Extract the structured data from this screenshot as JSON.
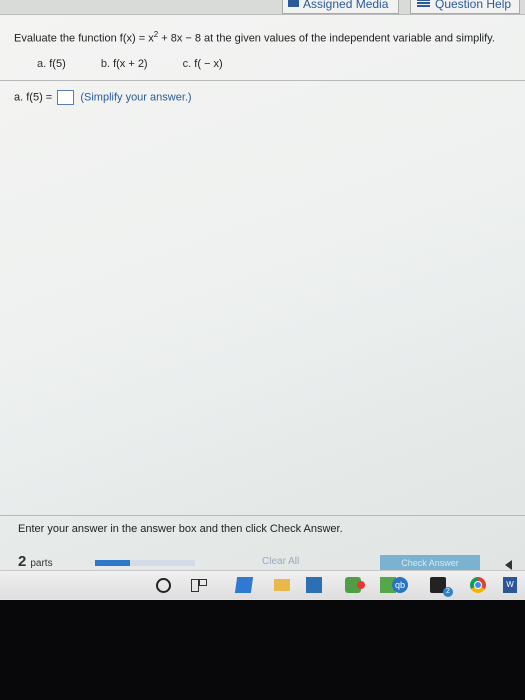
{
  "header": {
    "assigned_media": "Assigned Media",
    "question_help": "Question Help"
  },
  "question": {
    "prefix": "Evaluate the function f(x)",
    "eq": " = x",
    "exp": "2",
    "suffix": " + 8x − 8 at the given values of the independent variable and simplify.",
    "parts": [
      {
        "letter": "a.",
        "expr": "f(5)"
      },
      {
        "letter": "b.",
        "expr": "f(x + 2)"
      },
      {
        "letter": "c.",
        "expr": "f( − x)"
      }
    ]
  },
  "answer": {
    "label": "a.  f(5) =",
    "value": "",
    "hint": "(Simplify your answer.)"
  },
  "footer": {
    "instruction": "Enter your answer in the answer box and then click Check Answer.",
    "parts_count": "2",
    "parts_label": "parts",
    "progress": 0.35,
    "clear_all": "Clear All",
    "check_answer": "Check Answer"
  },
  "taskbar": {
    "qb_label": "qb",
    "mail_badge": "2",
    "word_label": "W"
  }
}
